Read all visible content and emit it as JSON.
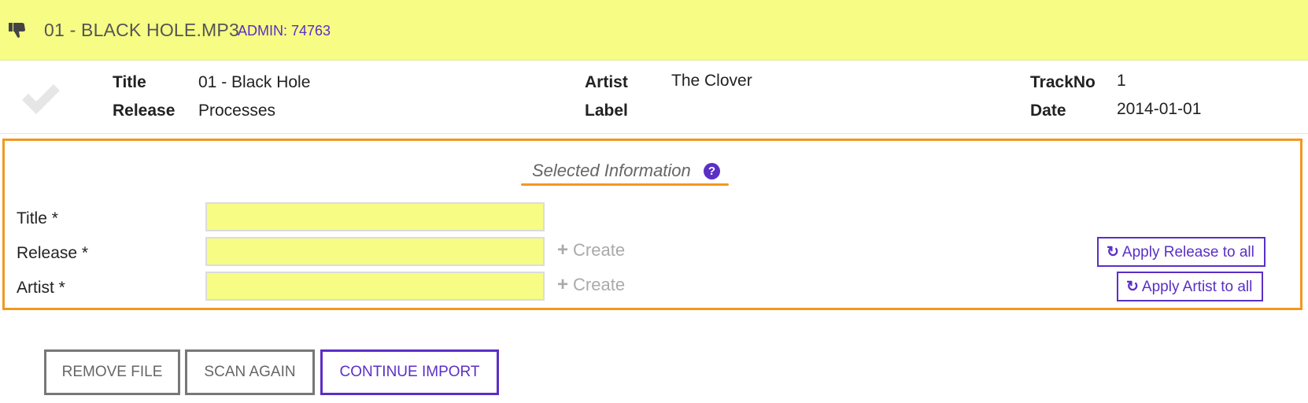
{
  "header": {
    "file_name": "01 - BLACK HOLE.MP3",
    "admin_tag": "ADMIN: 74763",
    "icon": "thumbs-down-icon"
  },
  "metadata": {
    "status_icon": "check-icon",
    "fields": [
      {
        "label": "Title",
        "value": "01 - Black Hole"
      },
      {
        "label": "Release",
        "value": "Processes"
      },
      {
        "label": "Artist",
        "value": "The Clover"
      },
      {
        "label": "Label",
        "value": ""
      },
      {
        "label": "TrackNo",
        "value": "1"
      },
      {
        "label": "Date",
        "value": "2014-01-01"
      }
    ]
  },
  "selected": {
    "title": "Selected Information",
    "help_icon": "?",
    "form": [
      {
        "label": "Title *",
        "value": ""
      },
      {
        "label": "Release *",
        "value": ""
      },
      {
        "label": "Artist *",
        "value": ""
      }
    ],
    "create_label": "Create",
    "apply_release_label": "Apply Release to all",
    "apply_artist_label": "Apply Artist to all"
  },
  "actions": {
    "remove_label": "REMOVE FILE",
    "scan_label": "SCAN AGAIN",
    "continue_label": "CONTINUE IMPORT"
  },
  "colors": {
    "highlight_yellow": "#f6fc84",
    "accent_purple": "#5a2fc6",
    "accent_orange": "#f2981f"
  }
}
